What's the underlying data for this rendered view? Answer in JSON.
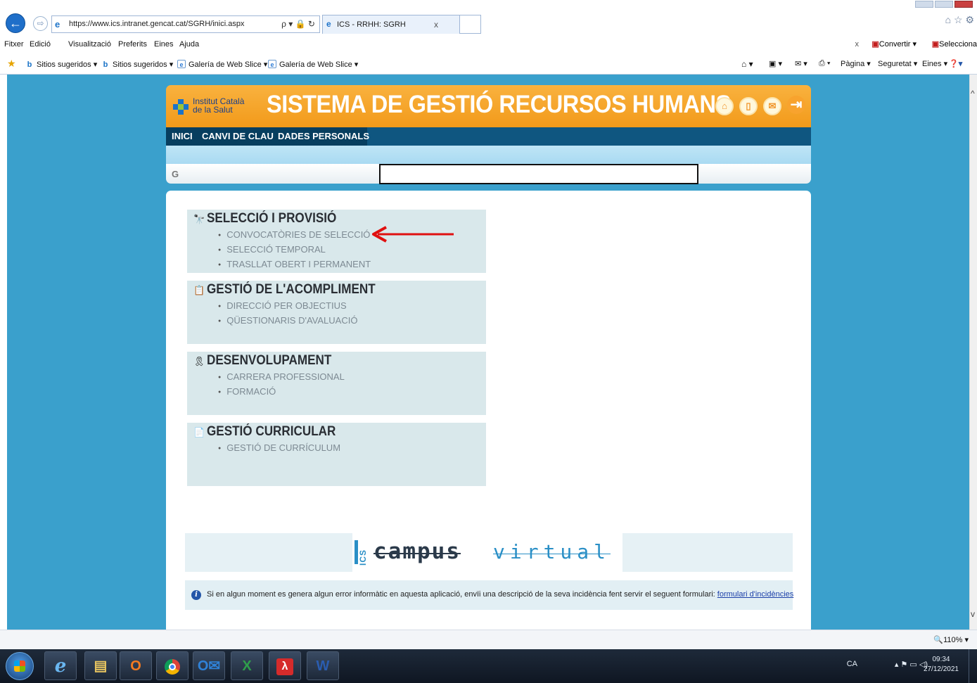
{
  "browser": {
    "url": "https://www.ics.intranet.gencat.cat/SGRH/inici.aspx",
    "url_controls": "ρ ▾ 🔒 ↻",
    "tab_title": "ICS - RRHH: SGRH",
    "tab_close": "x",
    "menu": [
      "Fitxer",
      "Edició",
      "Visualització",
      "Preferits",
      "Eines",
      "Ajuda"
    ],
    "menu_right": {
      "close": "x",
      "convert": "Convertir",
      "select": "Selecciona"
    },
    "favorites": [
      {
        "label": "Sitios sugeridos ▾",
        "icon": "bing-icon"
      },
      {
        "label": "Sitios sugeridos ▾",
        "icon": "bing-icon"
      },
      {
        "label": "Galería de Web Slice ▾",
        "icon": "web-slice-icon"
      },
      {
        "label": "Galería de Web Slice ▾",
        "icon": "web-slice-icon"
      }
    ],
    "commands": [
      "Pàgina ▾",
      "Seguretat ▾",
      "Eines ▾"
    ],
    "zoom": "110%"
  },
  "header": {
    "logo_line1": "Institut Català",
    "logo_line2": "de la Salut",
    "title": "SISTEMA DE GESTIÓ RECURSOS HUMANS",
    "icons": [
      "home-icon",
      "book-icon",
      "mail-icon",
      "logout-icon"
    ]
  },
  "nav": [
    "INICI",
    "CANVI DE CLAU",
    "DADES PERSONALS"
  ],
  "sections": [
    {
      "title": "SELECCIÓ I PROVISIÓ",
      "icon": "binoculars-icon",
      "items": [
        "CONVOCATÒRIES DE SELECCIÓ",
        "SELECCIÓ TEMPORAL",
        "TRASLLAT OBERT I PERMANENT"
      ]
    },
    {
      "title": "GESTIÓ DE L'ACOMPLIMENT",
      "icon": "clipboard-icon",
      "items": [
        "DIRECCIÓ PER OBJECTIUS",
        "QÜESTIONARIS D'AVALUACIÓ"
      ]
    },
    {
      "title": "DESENVOLUPAMENT",
      "icon": "award-icon",
      "items": [
        "CARRERA PROFESSIONAL",
        "FORMACIÓ"
      ]
    },
    {
      "title": "GESTIÓ CURRICULAR",
      "icon": "document-icon",
      "items": [
        "GESTIÓ DE CURRÍCULUM"
      ]
    }
  ],
  "campus": {
    "ics": "ICS",
    "word1": "campus",
    "word2": "virtual"
  },
  "info": {
    "text": "Si en algun moment es genera algun error informàtic en aquesta aplicació, envïi una descripció de la seva incidència fent servir el seguent formulari: ",
    "link": "formulari d'incidències"
  },
  "taskbar": {
    "apps": [
      "windows-start",
      "internet-explorer",
      "file-explorer",
      "outlook-o",
      "chrome",
      "outlook",
      "excel",
      "acrobat",
      "word"
    ],
    "lang": "CA",
    "time": "09:34",
    "date": "27/12/2021"
  },
  "colors": {
    "header_orange": "#f29a1a",
    "nav_blue": "#0f5680",
    "page_bg": "#3aa0cc",
    "section_bg": "#d9e8eb",
    "arrow_red": "#e01010"
  }
}
